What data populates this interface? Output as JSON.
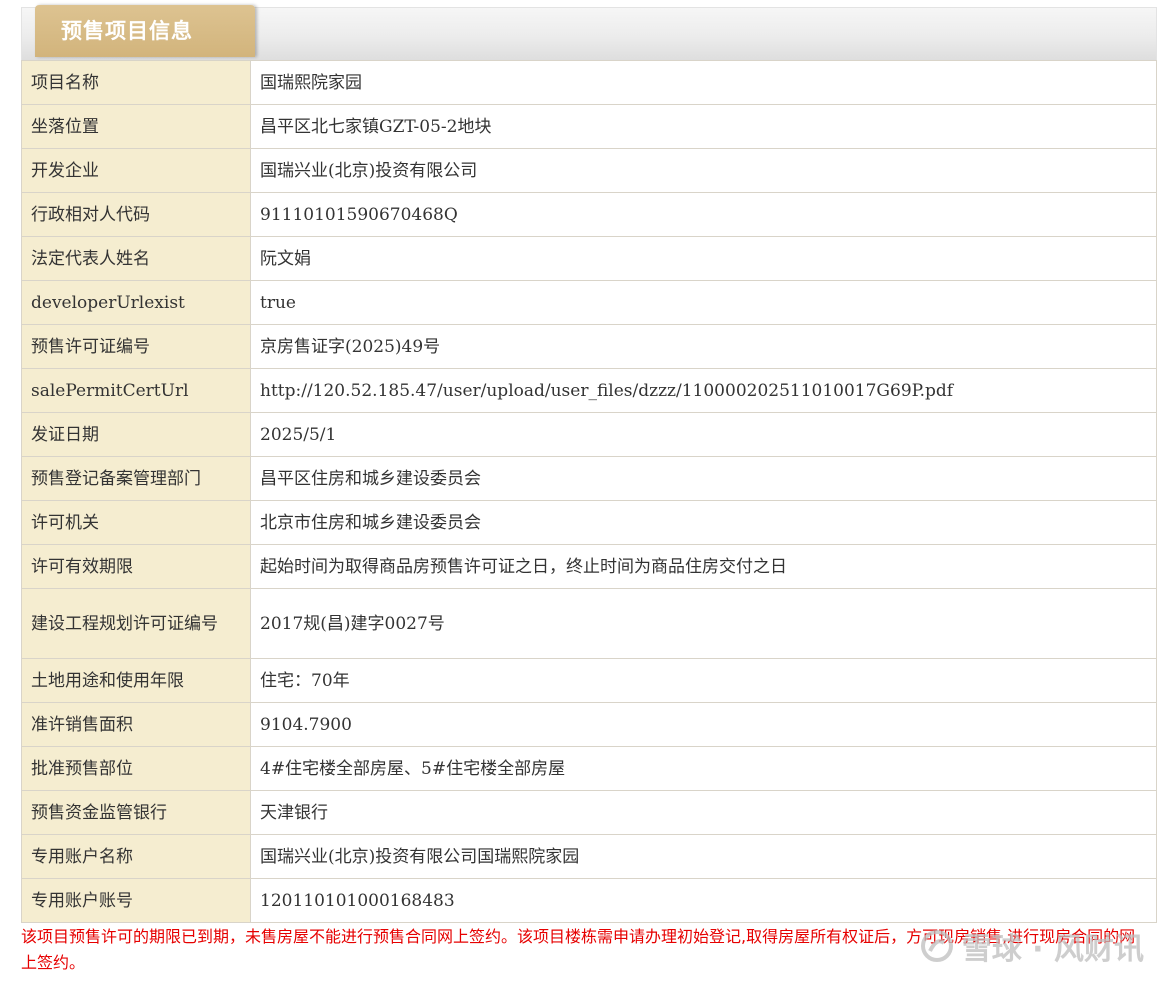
{
  "header": {
    "tab_label": "预售项目信息"
  },
  "rows": [
    {
      "label": "项目名称",
      "value": "国瑞熙院家园"
    },
    {
      "label": "坐落位置",
      "value": "昌平区北七家镇GZT-05-2地块"
    },
    {
      "label": "开发企业",
      "value": "国瑞兴业(北京)投资有限公司"
    },
    {
      "label": "行政相对人代码",
      "value": "91110101590670468Q"
    },
    {
      "label": "法定代表人姓名",
      "value": "阮文娟"
    },
    {
      "label": "developerUrlexist",
      "value": "true"
    },
    {
      "label": "预售许可证编号",
      "value": "京房售证字(2025)49号"
    },
    {
      "label": "salePermitCertUrl",
      "value": "http://120.52.185.47/user/upload/user_files/dzzz/110000202511010017G69P.pdf"
    },
    {
      "label": "发证日期",
      "value": "2025/5/1"
    },
    {
      "label": "预售登记备案管理部门",
      "value": "昌平区住房和城乡建设委员会"
    },
    {
      "label": "许可机关",
      "value": "北京市住房和城乡建设委员会"
    },
    {
      "label": "许可有效期限",
      "value": "起始时间为取得商品房预售许可证之日，终止时间为商品住房交付之日"
    },
    {
      "label": "建设工程规划许可证编号",
      "value": "2017规(昌)建字0027号"
    },
    {
      "label": "土地用途和使用年限",
      "value": "住宅：70年"
    },
    {
      "label": "准许销售面积",
      "value": "9104.7900"
    },
    {
      "label": "批准预售部位",
      "value": "4#住宅楼全部房屋、5#住宅楼全部房屋"
    },
    {
      "label": "预售资金监管银行",
      "value": "天津银行"
    },
    {
      "label": "专用账户名称",
      "value": "国瑞兴业(北京)投资有限公司国瑞熙院家园"
    },
    {
      "label": "专用账户账号",
      "value": "120110101000168483"
    }
  ],
  "notice": "该项目预售许可的期限已到期，未售房屋不能进行预售合同网上签约。该项目楼栋需申请办理初始登记,取得房屋所有权证后，方可现房销售,进行现房合同的网上签约。",
  "watermark": {
    "text": "雪球 · 风财讯",
    "icon": "snowball-logo-icon"
  }
}
